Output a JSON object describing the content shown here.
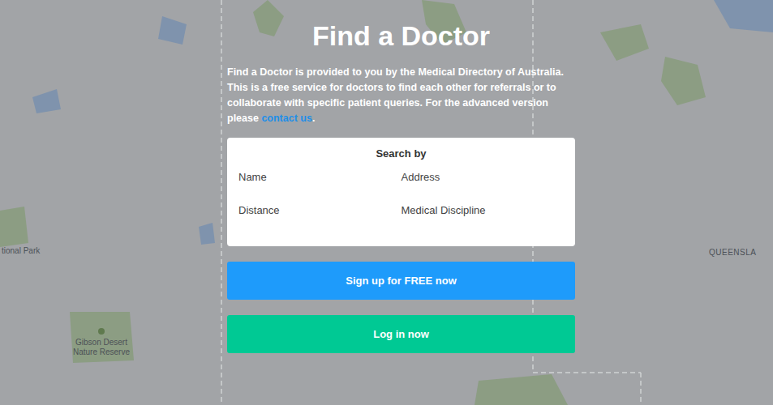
{
  "title": "Find a Doctor",
  "intro": {
    "text": "Find a Doctor is provided to you by the Medical Directory of Australia. This is a free service for doctors to find each other for referrals or to collaborate with specific patient queries. For the advanced version please ",
    "link": "contact us",
    "end": "."
  },
  "search": {
    "heading": "Search by",
    "fields": [
      "Name",
      "Address",
      "Distance",
      "Medical Discipline"
    ]
  },
  "buttons": [
    {
      "label": "Sign up for FREE now",
      "color": "#1e9bfb"
    },
    {
      "label": "Log in now",
      "color": "#00c994"
    }
  ],
  "map_labels": [
    "tional Park",
    "Gibson Desert Nature Reserve",
    "QUEENSLA"
  ]
}
